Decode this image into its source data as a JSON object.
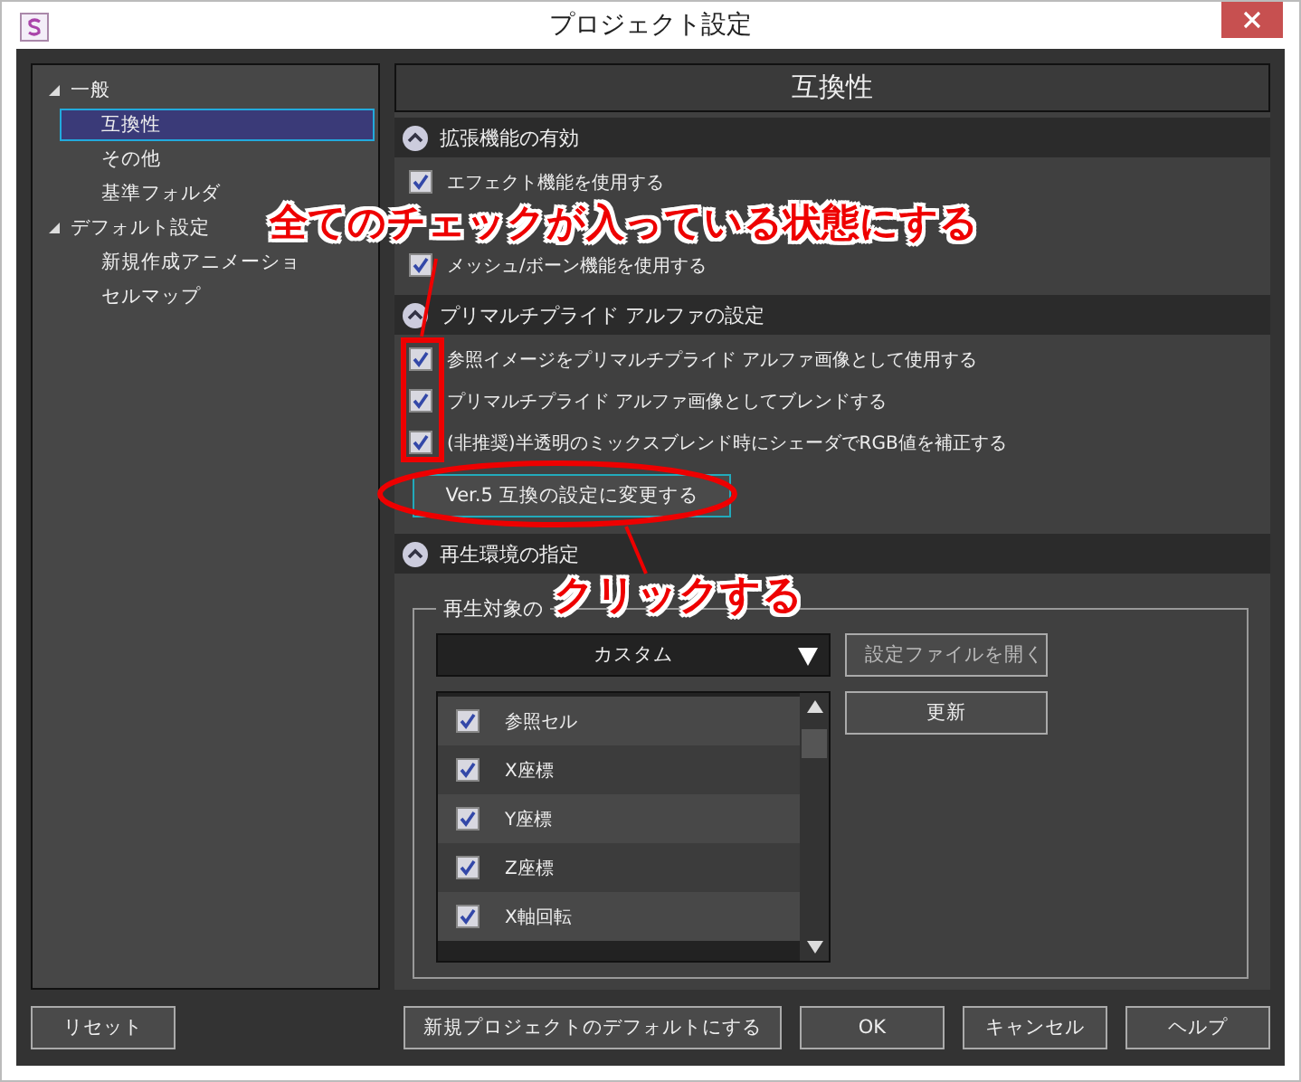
{
  "window": {
    "title": "プロジェクト設定"
  },
  "sidebar": {
    "items": [
      {
        "label": "一般",
        "expanded": true,
        "selected": false,
        "children": [
          {
            "label": "互換性",
            "selected": true
          },
          {
            "label": "その他",
            "selected": false
          },
          {
            "label": "基準フォルダ",
            "selected": false
          }
        ]
      },
      {
        "label": "デフォルト設定",
        "expanded": true,
        "selected": false,
        "children": [
          {
            "label": "新規作成アニメーショ",
            "selected": false
          },
          {
            "label": "セルマップ",
            "selected": false
          }
        ]
      }
    ]
  },
  "panel": {
    "title": "互換性",
    "sections": [
      {
        "title": "拡張機能の有効",
        "expanded": true,
        "options": [
          {
            "label": "エフェクト機能を使用する",
            "checked": true
          },
          {
            "label": "メッシュ/ボーン機能を使用する",
            "checked": true
          }
        ]
      },
      {
        "title": "プリマルチプライド アルファの設定",
        "expanded": true,
        "options": [
          {
            "label": "参照イメージをプリマルチプライド アルファ画像として使用する",
            "checked": true
          },
          {
            "label": "プリマルチプライド アルファ画像としてブレンドする",
            "checked": true
          },
          {
            "label": "(非推奨)半透明のミックスブレンド時にシェーダでRGB値を補正する",
            "checked": true
          }
        ],
        "button": "Ver.5 互換の設定に変更する"
      },
      {
        "title": "再生環境の指定",
        "expanded": true,
        "group": {
          "legend": "再生対象の",
          "dropdown": "カスタム",
          "buttons": [
            "設定ファイルを開く",
            "更新"
          ],
          "items": [
            {
              "label": "参照セル",
              "checked": true
            },
            {
              "label": "X座標",
              "checked": true
            },
            {
              "label": "Y座標",
              "checked": true
            },
            {
              "label": "Z座標",
              "checked": true
            },
            {
              "label": "X軸回転",
              "checked": true
            }
          ]
        }
      }
    ]
  },
  "footer": {
    "left": [
      "リセット"
    ],
    "right": [
      "新規プロジェクトのデフォルトにする",
      "OK",
      "キャンセル",
      "ヘルプ"
    ]
  },
  "annotations": [
    {
      "text": "全てのチェックが入っている状態にする"
    },
    {
      "text": "クリックする"
    }
  ]
}
